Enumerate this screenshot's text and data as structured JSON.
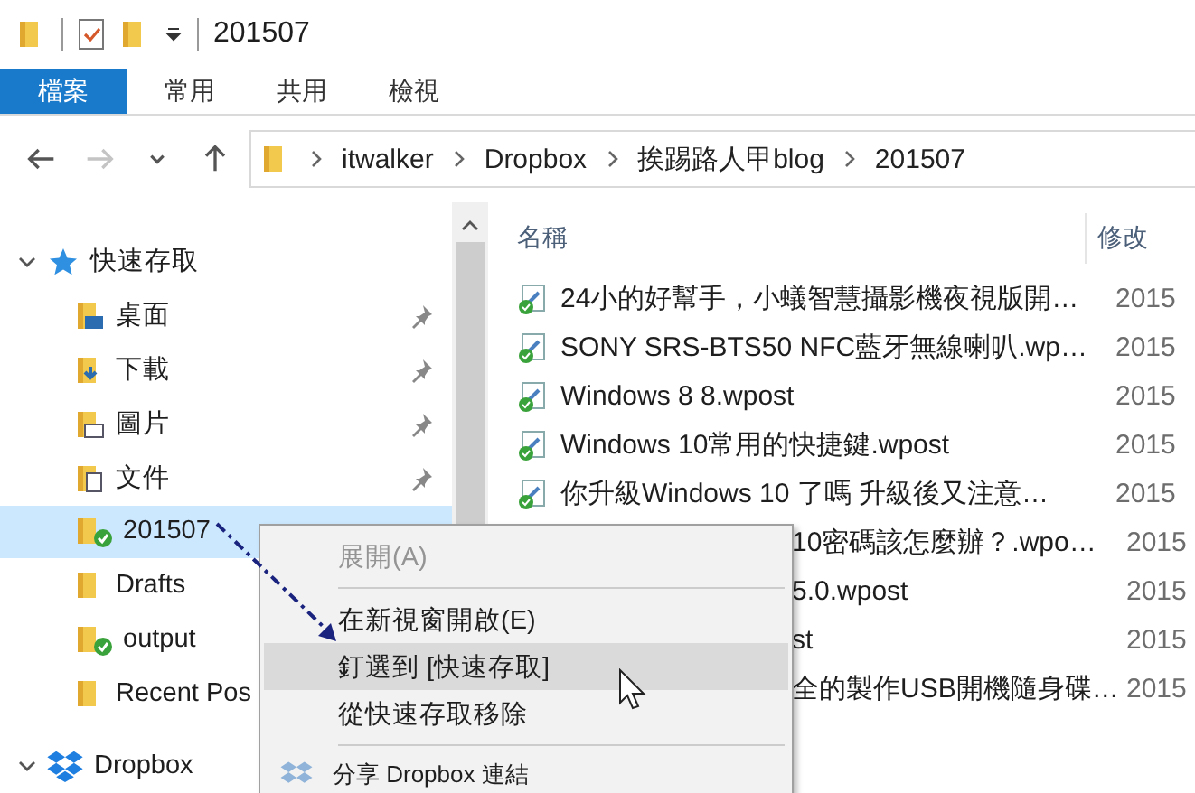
{
  "title_bar": {
    "title": "201507"
  },
  "ribbon_tabs": [
    {
      "label": "檔案",
      "selected": true
    },
    {
      "label": "常用",
      "selected": false
    },
    {
      "label": "共用",
      "selected": false
    },
    {
      "label": "檢視",
      "selected": false
    }
  ],
  "nav_buttons": [
    {
      "kind": "back",
      "disabled": false
    },
    {
      "kind": "forward",
      "disabled": true
    },
    {
      "kind": "recent",
      "disabled": false
    },
    {
      "kind": "up",
      "disabled": false
    }
  ],
  "address": {
    "path": [
      "itwalker",
      "Dropbox",
      "挨踢路人甲blog",
      "201507"
    ]
  },
  "sidebar": {
    "items": [
      {
        "label": "快速存取",
        "kind": "star",
        "expanded": true,
        "selected": false,
        "children": [
          {
            "label": "桌面",
            "kind": "desktop",
            "pinned": true,
            "synced": false,
            "selected": false
          },
          {
            "label": "下載",
            "kind": "download",
            "pinned": true,
            "synced": false,
            "selected": false
          },
          {
            "label": "圖片",
            "kind": "pictures",
            "pinned": true,
            "synced": false,
            "selected": false
          },
          {
            "label": "文件",
            "kind": "documents",
            "pinned": true,
            "synced": false,
            "selected": false
          },
          {
            "label": "201507",
            "kind": "folder",
            "pinned": false,
            "synced": true,
            "selected": true
          },
          {
            "label": "Drafts",
            "kind": "folder",
            "pinned": false,
            "synced": false,
            "selected": false
          },
          {
            "label": "output",
            "kind": "folder",
            "pinned": false,
            "synced": true,
            "selected": false
          },
          {
            "label": "Recent Pos",
            "kind": "folder",
            "pinned": false,
            "synced": false,
            "selected": false
          }
        ]
      },
      {
        "label": "Dropbox",
        "kind": "dropbox",
        "expanded": true,
        "selected": false
      }
    ]
  },
  "file_list": {
    "columns": [
      "名稱",
      "修改"
    ],
    "rows": [
      {
        "name": "24小的好幫手，小蟻智慧攝影機夜視版開…",
        "date": "2015",
        "kind": "file"
      },
      {
        "name": "SONY SRS-BTS50 NFC藍牙無線喇叭.wp…",
        "date": "2015",
        "kind": "file"
      },
      {
        "name": "Windows 8 8.wpost",
        "date": "2015",
        "kind": "file"
      },
      {
        "name": "Windows 10常用的快捷鍵.wpost",
        "date": "2015",
        "kind": "file"
      },
      {
        "name": "你升級Windows 10 了嗎 升級後又注意…",
        "date": "2015",
        "kind": "file"
      },
      {
        "name": "10密碼該怎麼辦？.wpo…",
        "date": "2015",
        "kind": "covered"
      },
      {
        "name": "5.0.wpost",
        "date": "2015",
        "kind": "covered"
      },
      {
        "name": "st",
        "date": "2015",
        "kind": "covered"
      },
      {
        "name": "全的製作USB開機隨身碟…",
        "date": "2015",
        "kind": "covered"
      }
    ]
  },
  "context_menu": {
    "items": [
      {
        "kind": "item",
        "label": "展開(A)",
        "disabled": true,
        "selected": false
      },
      {
        "kind": "separator"
      },
      {
        "kind": "item",
        "label": "在新視窗開啟(E)",
        "disabled": false,
        "selected": false
      },
      {
        "kind": "item",
        "label": "釘選到 [快速存取]",
        "disabled": false,
        "selected": true
      },
      {
        "kind": "item",
        "label": "從快速存取移除",
        "disabled": false,
        "selected": false
      },
      {
        "kind": "separator"
      },
      {
        "kind": "share",
        "label": "分享 Dropbox 連結"
      }
    ]
  }
}
